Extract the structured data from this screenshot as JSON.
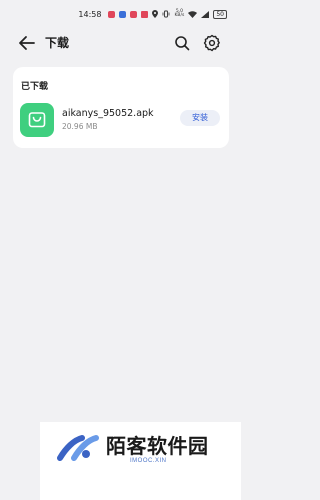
{
  "status_bar": {
    "time": "14:58",
    "network_speed_top": "5.0",
    "network_speed_bottom": "KB/s",
    "battery": "50",
    "notification_colors": [
      "#e0465a",
      "#3a6fd8",
      "#e0465a",
      "#e0465a"
    ]
  },
  "app_bar": {
    "title": "下载"
  },
  "downloads": {
    "section_title": "已下载",
    "items": [
      {
        "file_name": "aikanys_95052.apk",
        "file_size": "20.96 MB",
        "action_label": "安装",
        "icon": "shopping-bag-icon",
        "icon_color": "#3fcf7f"
      }
    ]
  },
  "watermark": {
    "brand": "陌客软件园",
    "sub": "IMOOC.XIN"
  }
}
